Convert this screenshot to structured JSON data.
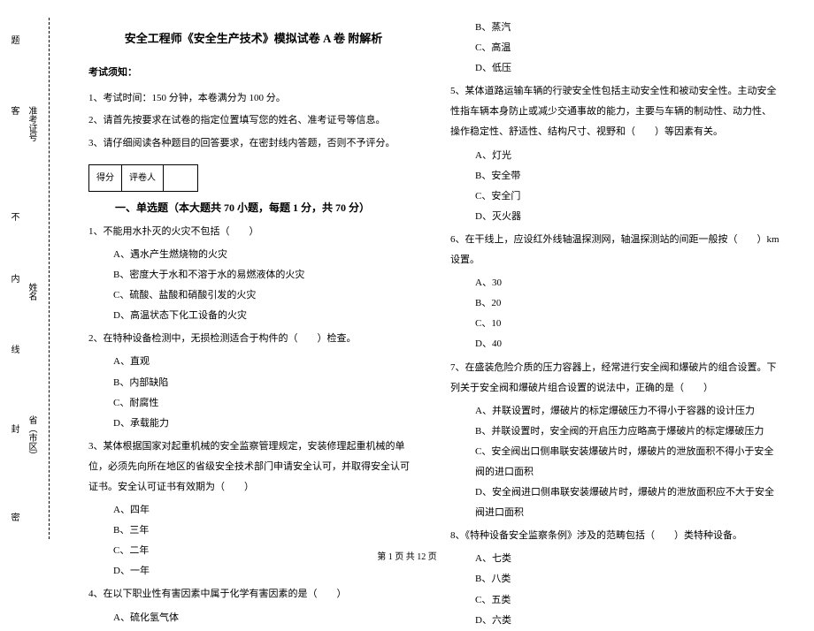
{
  "binding": {
    "field_province": "省（市区）",
    "field_name": "姓名",
    "field_ticket": "准考证号",
    "seal": "密",
    "feng": "封",
    "xian": "线",
    "nei": "内",
    "bu": "不",
    "ke": "客",
    "ti": "题"
  },
  "header": {
    "title": "安全工程师《安全生产技术》模拟试卷 A 卷  附解析"
  },
  "notice": {
    "head": "考试须知：",
    "items": [
      "1、考试时间：150 分钟，本卷满分为 100 分。",
      "2、请首先按要求在试卷的指定位置填写您的姓名、准考证号等信息。",
      "3、请仔细阅读各种题目的回答要求，在密封线内答题，否则不予评分。"
    ]
  },
  "scorebox": {
    "label_score": "得分",
    "label_grader": "评卷人"
  },
  "section1": {
    "head": "一、单选题（本大题共 70 小题，每题 1 分，共 70 分）"
  },
  "left": {
    "q1": "1、不能用水扑灭的火灾不包括（　　）",
    "q1a": "A、遇水产生燃烧物的火灾",
    "q1b": "B、密度大于水和不溶于水的易燃液体的火灾",
    "q1c": "C、硫酸、盐酸和硝酸引发的火灾",
    "q1d": "D、高温状态下化工设备的火灾",
    "q2": "2、在特种设备检测中，无损检测适合于构件的（　　）检查。",
    "q2a": "A、直观",
    "q2b": "B、内部缺陷",
    "q2c": "C、耐腐性",
    "q2d": "D、承载能力",
    "q3": "3、某体根据国家对起重机械的安全监察管理规定，安装修理起重机械的单位，必须先向所在地区的省级安全技术部门申请安全认可，并取得安全认可证书。安全认可证书有效期为（　　）",
    "q3a": "A、四年",
    "q3b": "B、三年",
    "q3c": "C、二年",
    "q3d": "D、一年",
    "q4": "4、在以下职业性有害因素中属于化学有害因素的是（　　）",
    "q4a": "A、硫化氢气体"
  },
  "right": {
    "q4b": "B、蒸汽",
    "q4c": "C、高温",
    "q4d": "D、低压",
    "q5": "5、某体道路运输车辆的行驶安全性包括主动安全性和被动安全性。主动安全性指车辆本身防止或减少交通事故的能力，主要与车辆的制动性、动力性、操作稳定性、舒适性、结构尺寸、视野和（　　）等因素有关。",
    "q5a": "A、灯光",
    "q5b": "B、安全带",
    "q5c": "C、安全门",
    "q5d": "D、灭火器",
    "q6": "6、在干线上，应设红外线轴温探测网，轴温探测站的间距一般按（　　）km 设置。",
    "q6a": "A、30",
    "q6b": "B、20",
    "q6c": "C、10",
    "q6d": "D、40",
    "q7": "7、在盛装危险介质的压力容器上，经常进行安全阀和爆破片的组合设置。下列关于安全阀和爆破片组合设置的说法中，正确的是（　　）",
    "q7a": "A、并联设置时，爆破片的标定爆破压力不得小于容器的设计压力",
    "q7b": "B、并联设置时，安全阀的开启压力应略高于爆破片的标定爆破压力",
    "q7c": "C、安全阀出口侧串联安装爆破片时，爆破片的泄放面积不得小于安全阀的进口面积",
    "q7d": "D、安全阀进口侧串联安装爆破片时，爆破片的泄放面积应不大于安全阀进口面积",
    "q8": "8、《特种设备安全监察条例》涉及的范畴包括（　　）类特种设备。",
    "q8a": "A、七类",
    "q8b": "B、八类",
    "q8c": "C、五类",
    "q8d": "D、六类"
  },
  "footer": "第 1 页 共 12 页"
}
